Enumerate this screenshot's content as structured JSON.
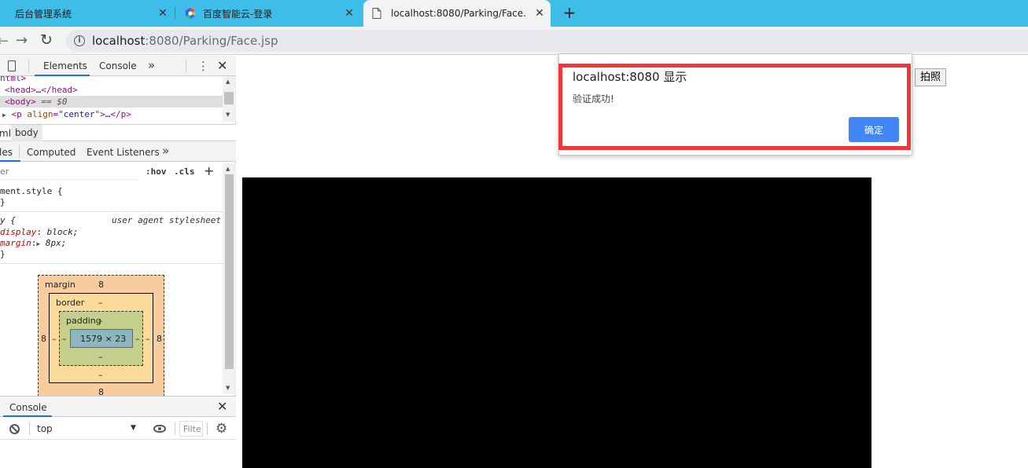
{
  "browser": {
    "tabs": [
      {
        "title": "后台管理系统"
      },
      {
        "title": "百度智能云-登录"
      },
      {
        "title": "localhost:8080/Parking/Face.jsp"
      }
    ],
    "new_tab_label": "+",
    "url_host": "localhost",
    "url_path": ":8080/Parking/Face.jsp"
  },
  "devtools": {
    "tabs": {
      "elements": "Elements",
      "console": "Console",
      "more": "»"
    },
    "dom": {
      "line0": "html>",
      "line1_tag": "<head>",
      "line1_ell": "…",
      "line1_close": "</head>",
      "line2_tag": "<body>",
      "line2_dim": " == $0",
      "line3_open": "<p ",
      "line3_attr": "align",
      "line3_eq": "=\"",
      "line3_val": "center",
      "line3_rest": "\">",
      "line3_ell": "…",
      "line3_close": "</p>"
    },
    "breadcrumbs": {
      "html": "ml",
      "body": "body"
    },
    "subtabs": {
      "styles": "les",
      "computed": "Computed",
      "event_listeners": "Event Listeners"
    },
    "filter": {
      "placeholder": "er",
      "hov": ":hov",
      "cls": ".cls"
    },
    "styles": {
      "element_style": "ment.style {",
      "element_style_close": "}",
      "selector": "y {",
      "ua_label": "user agent stylesheet",
      "display_prop": "display",
      "display_val": "block;",
      "margin_prop": "margin",
      "margin_val": "8px;",
      "close": "}"
    },
    "box_model": {
      "margin_label": "margin",
      "margin_top": "8",
      "margin_left": "8",
      "margin_right": "8",
      "margin_bottom": "8",
      "border_label": "border",
      "border_top": "–",
      "border_left": "–",
      "border_right": "–",
      "border_bottom": "–",
      "padding_label": "padding",
      "padding_top": "–",
      "padding_left": "–",
      "padding_right": "–",
      "padding_bottom": "–",
      "content": "1579 × 23"
    },
    "drawer": {
      "tab": "Console",
      "context": "top",
      "filter": "Filte"
    }
  },
  "page": {
    "photo_button": "拍照"
  },
  "dialog": {
    "title": "localhost:8080 显示",
    "message": "验证成功!",
    "ok_label": "确定"
  },
  "colors": {
    "tabstrip": "#3dbde8",
    "dialog_button": "#4285f4",
    "highlight": "#f2363a"
  }
}
